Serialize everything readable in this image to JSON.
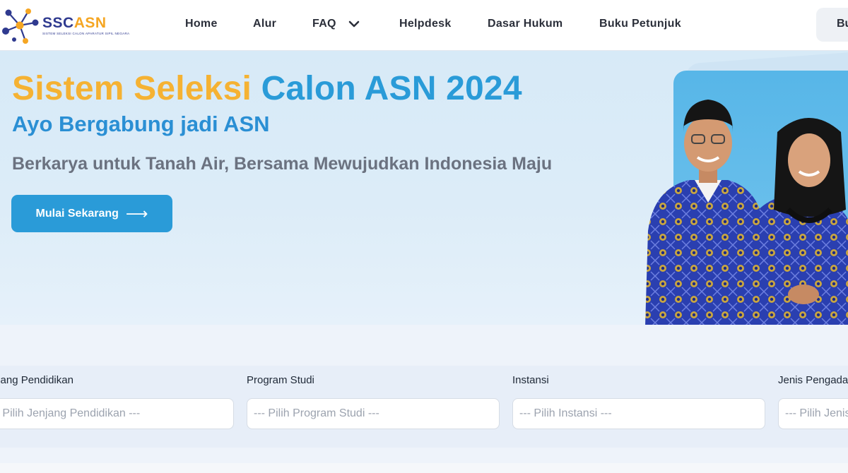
{
  "logo": {
    "word_ss": "SSC",
    "word_asn": "ASN",
    "subtitle": "SISTEM SELEKSI CALON APARATUR SIPIL NEGARA"
  },
  "nav": {
    "items": [
      "Home",
      "Alur",
      "FAQ",
      "Helpdesk",
      "Dasar Hukum",
      "Buku Petunjuk"
    ],
    "top_button": "Bu"
  },
  "hero": {
    "title_part1": "Sistem Seleksi",
    "title_part2": "Calon ASN 2024",
    "subtitle": "Ayo Bergabung jadi ASN",
    "description": "Berkarya untuk Tanah Air, Bersama Mewujudkan Indonesia Maju",
    "cta_label": "Mulai Sekarang",
    "cta_arrow": "⟶"
  },
  "filters": [
    {
      "label": "Jenjang Pendidikan",
      "placeholder": "--- Pilih Jenjang Pendidikan ---"
    },
    {
      "label": "Program Studi",
      "placeholder": "--- Pilih Program Studi ---"
    },
    {
      "label": "Instansi",
      "placeholder": "--- Pilih Instansi ---"
    },
    {
      "label": "Jenis Pengadaan",
      "placeholder": "--- Pilih Jenis Pengadaan ---"
    }
  ],
  "colors": {
    "brand_orange": "#f5b233",
    "brand_blue": "#2a9bd8",
    "logo_navy": "#2f3a8f"
  },
  "icons": [
    "logo-icon",
    "chevron-down-icon",
    "arrow-right-icon"
  ]
}
